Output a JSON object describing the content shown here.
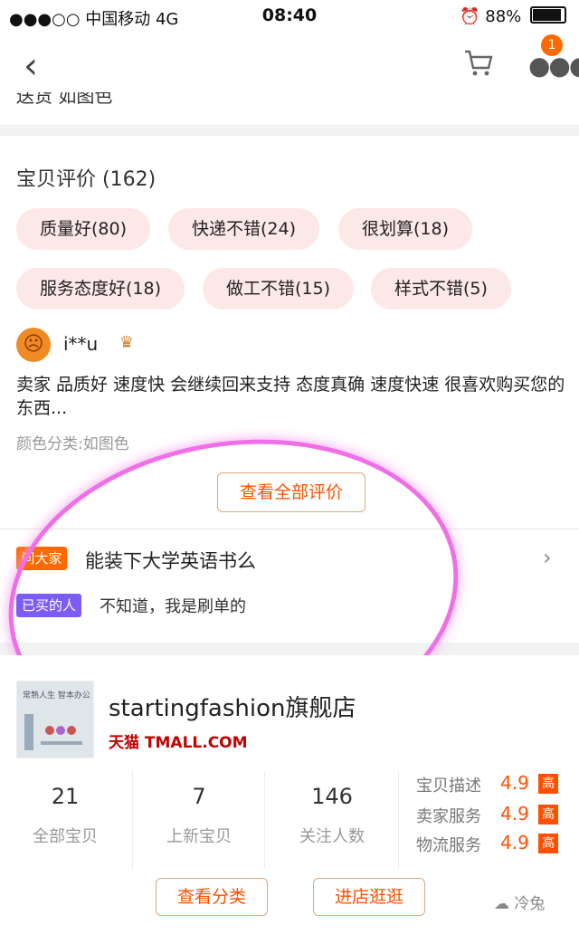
{
  "status_bar": {
    "carrier": "●●●○○ 中国移动  4G",
    "time": "08:40",
    "battery": "88%"
  },
  "nav": {
    "back_icon": "chevron-left-icon",
    "cart_icon": "cart-icon",
    "more_icon": "more-icon",
    "badge": "1"
  },
  "partial_row": "送货  如图色",
  "reviews": {
    "title": "宝贝评价 (162)",
    "tags": [
      "质量好(80)",
      "快递不错(24)",
      "很划算(18)",
      "服务态度好(18)",
      "做工不错(15)",
      "样式不错(5)"
    ],
    "user": "i**u",
    "text": "卖家 品质好 速度快 会继续回来支持 态度真确 速度快速 很喜欢购买您的东西...",
    "color_class": "颜色分类:如图色",
    "view_all": "查看全部评价"
  },
  "ask": {
    "tag": "问大家",
    "question": "能装下大学英语书么",
    "buyer_tag": "已买的人",
    "answer": "不知道，我是刷单的"
  },
  "shop": {
    "logo_lines": [
      "常熟人生 智本办公"
    ],
    "name": "startingfashion旗舰店",
    "platform": "天猫 TMALL.COM",
    "stats": [
      {
        "value": "21",
        "label": "全部宝贝"
      },
      {
        "value": "7",
        "label": "上新宝贝"
      },
      {
        "value": "146",
        "label": "关注人数"
      }
    ],
    "scores": [
      {
        "label": "宝贝描述",
        "value": "4.9",
        "level": "高"
      },
      {
        "label": "卖家服务",
        "value": "4.9",
        "level": "高"
      },
      {
        "label": "物流服务",
        "value": "4.9",
        "level": "高"
      }
    ],
    "buttons": {
      "category": "查看分类",
      "enter": "进店逛逛"
    }
  },
  "watermark": "冷兔",
  "colors": {
    "accent": "#ff5000",
    "tag_bg": "#fde8e8",
    "halo": "#f06fe6"
  }
}
